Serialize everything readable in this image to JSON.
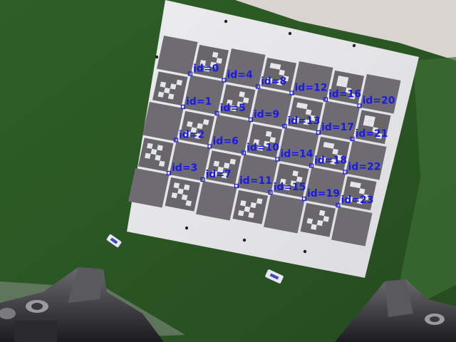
{
  "scene": {
    "description_colors": {
      "table": "#2c5a25",
      "paper": "#e8e8ea",
      "square": "#6d6b70",
      "label": "#1a1ae6"
    }
  },
  "markers": [
    {
      "label": "id=0"
    },
    {
      "label": "id=1"
    },
    {
      "label": "id=2"
    },
    {
      "label": "id=3"
    },
    {
      "label": "id=4"
    },
    {
      "label": "id=5"
    },
    {
      "label": "id=6"
    },
    {
      "label": "id=7"
    },
    {
      "label": "id=8"
    },
    {
      "label": "id=9"
    },
    {
      "label": "id=10"
    },
    {
      "label": "id=11"
    },
    {
      "label": "id=12"
    },
    {
      "label": "id=13"
    },
    {
      "label": "id=14"
    },
    {
      "label": "id=15"
    },
    {
      "label": "id=16"
    },
    {
      "label": "id=17"
    },
    {
      "label": "id=18"
    },
    {
      "label": "id=19"
    },
    {
      "label": "id=20"
    },
    {
      "label": "id=21"
    },
    {
      "label": "id=22"
    },
    {
      "label": "id=23"
    }
  ]
}
